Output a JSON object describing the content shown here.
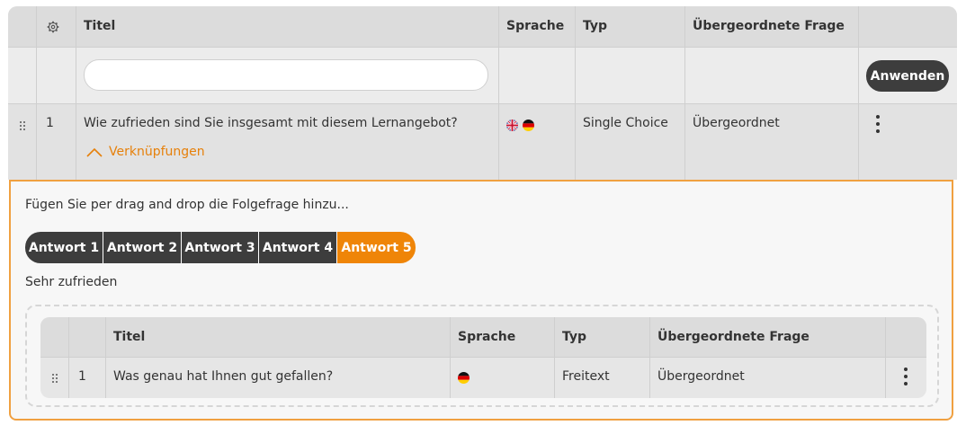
{
  "main_table": {
    "headers": {
      "title": "Titel",
      "language": "Sprache",
      "type": "Typ",
      "parent": "Übergeordnete Frage"
    },
    "apply_label": "Anwenden",
    "row": {
      "num": "1",
      "title": "Wie zufrieden sind Sie insgesamt mit diesem Lernangebot?",
      "type": "Single Choice",
      "parent": "Übergeordnet",
      "link": "Verknüpfungen"
    }
  },
  "panel": {
    "hint": "Fügen Sie per drag and drop die Folgefrage hinzu...",
    "answers": [
      "Antwort 1",
      "Antwort 2",
      "Antwort 3",
      "Antwort 4",
      "Antwort 5"
    ],
    "active_answer": "Antwort 5",
    "answer_text": "Sehr zufrieden"
  },
  "sub_table": {
    "headers": {
      "title": "Titel",
      "language": "Sprache",
      "type": "Typ",
      "parent": "Übergeordnete Frage"
    },
    "row": {
      "num": "1",
      "title": "Was genau hat Ihnen gut gefallen?",
      "type": "Freitext",
      "parent": "Übergeordnet"
    }
  },
  "colors": {
    "accent": "#ef8508",
    "dark": "#3d3d3d",
    "header_bg": "#dcdcdc"
  }
}
